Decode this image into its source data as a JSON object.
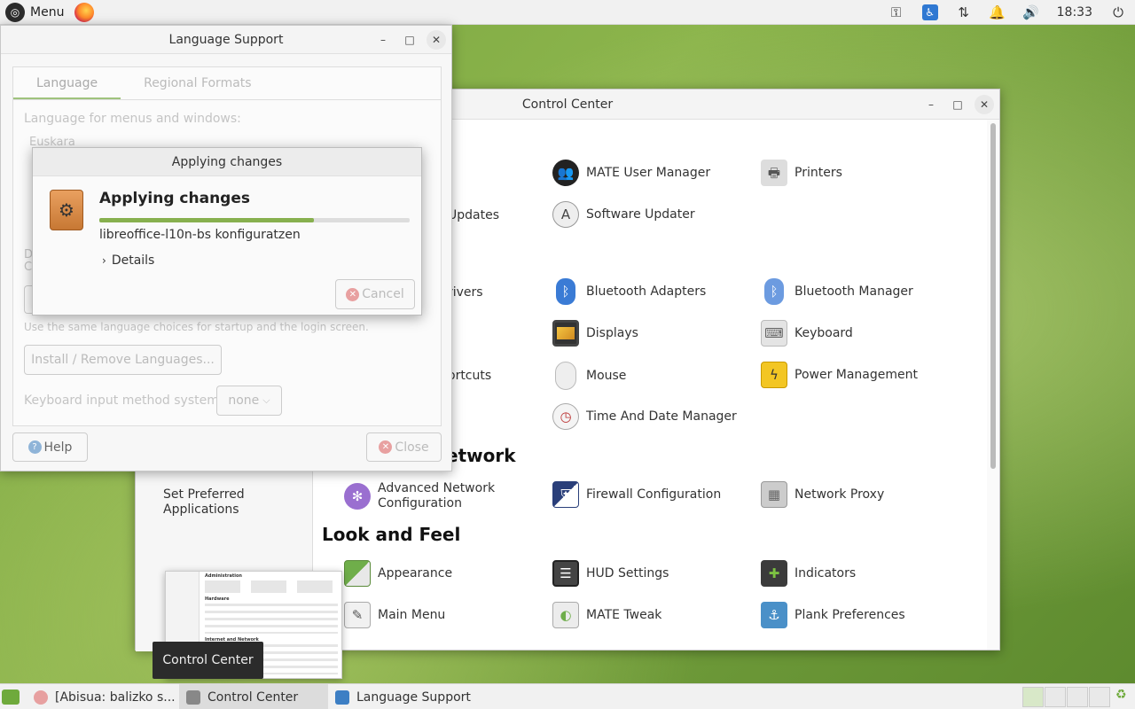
{
  "top_panel": {
    "menu_label": "Menu",
    "clock": "18:33",
    "tray_icons": [
      "key-icon",
      "accessibility-icon",
      "network-icon",
      "notification-bell-icon",
      "volume-icon",
      "power-icon"
    ]
  },
  "control_center": {
    "title": "Control Center",
    "sidebar": {
      "items": [
        {
          "label": "Set Preferred Applications"
        }
      ]
    },
    "sections": {
      "network": "Internet and Network",
      "network_visible": "etwork",
      "look": "Look and Feel"
    },
    "items": {
      "user_manager": "MATE User Manager",
      "printers": "Printers",
      "updates": "Updates",
      "software_updater": "Software Updater",
      "drivers": "rivers",
      "bt_adapters": "Bluetooth Adapters",
      "bt_manager": "Bluetooth Manager",
      "displays": "Displays",
      "keyboard": "Keyboard",
      "shortcuts": "ortcuts",
      "mouse": "Mouse",
      "power": "Power Management",
      "time_date": "Time And Date Manager",
      "adv_network": "Advanced Network Configuration",
      "firewall": "Firewall Configuration",
      "proxy": "Network Proxy",
      "appearance": "Appearance",
      "hud": "HUD Settings",
      "indicators": "Indicators",
      "main_menu": "Main Menu",
      "tweak": "MATE Tweak",
      "plank": "Plank Preferences"
    }
  },
  "language_support": {
    "title": "Language Support",
    "tabs": [
      {
        "label": "Language"
      },
      {
        "label": "Regional Formats"
      }
    ],
    "menus_label": "Language for menus and windows:",
    "first_language": "Euskara",
    "hidden_text_1": "D",
    "hidden_text_2": "C",
    "same_choices_text": "Use the same language choices for startup and the login screen.",
    "install_button": "Install / Remove Languages...",
    "input_method_label": "Keyboard input method system:",
    "input_method_value": "none",
    "help_button": "Help",
    "close_button": "Close"
  },
  "dialog": {
    "title": "Applying changes",
    "heading": "Applying changes",
    "progress": 0.69,
    "status": "libreoffice-l10n-bs konfiguratzen",
    "details": "Details",
    "cancel": "Cancel"
  },
  "preview": {
    "headings": [
      "Administration",
      "Hardware",
      "Internet and Network"
    ],
    "tooltip": "Control Center"
  },
  "taskbar": {
    "tasks": [
      {
        "label": "[Abisua: balizko s..."
      },
      {
        "label": "Control Center"
      },
      {
        "label": "Language Support"
      }
    ]
  },
  "colors": {
    "accent_green": "#87b04e",
    "bluetooth_blue": "#3a7bd5"
  }
}
